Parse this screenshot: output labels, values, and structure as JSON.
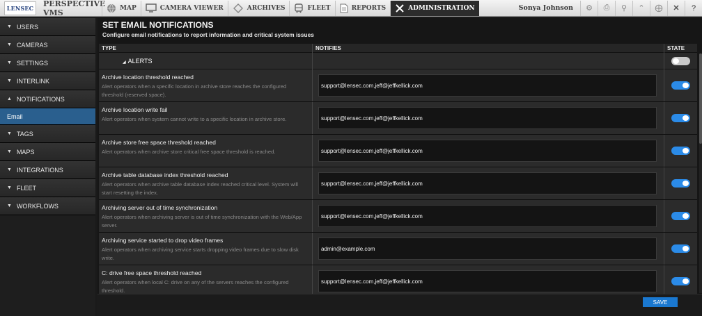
{
  "app": {
    "logo": "LENSEC",
    "product": "PERSPECTIVE VMS",
    "user": "Sonya Johnson"
  },
  "nav": [
    {
      "label": "MAP",
      "icon": "globe-icon"
    },
    {
      "label": "CAMERA VIEWER",
      "icon": "monitor-icon"
    },
    {
      "label": "ARCHIVES",
      "icon": "archive-icon"
    },
    {
      "label": "FLEET",
      "icon": "bus-icon"
    },
    {
      "label": "REPORTS",
      "icon": "document-icon"
    },
    {
      "label": "ADMINISTRATION",
      "icon": "tools-icon",
      "active": true
    }
  ],
  "toolbar_icons": [
    "gear-icon",
    "printer-icon",
    "search-icon",
    "collapse-icon",
    "fullscreen-icon",
    "close-icon",
    "help-icon"
  ],
  "sidebar": [
    {
      "label": "USERS",
      "expanded": false
    },
    {
      "label": "CAMERAS",
      "expanded": false
    },
    {
      "label": "SETTINGS",
      "expanded": false
    },
    {
      "label": "INTERLINK",
      "expanded": false
    },
    {
      "label": "NOTIFICATIONS",
      "expanded": true
    },
    {
      "label": "Email",
      "sub": true
    },
    {
      "label": "TAGS",
      "expanded": false
    },
    {
      "label": "MAPS",
      "expanded": false
    },
    {
      "label": "INTEGRATIONS",
      "expanded": false
    },
    {
      "label": "FLEET",
      "expanded": false
    },
    {
      "label": "WORKFLOWS",
      "expanded": false
    }
  ],
  "page": {
    "title": "SET EMAIL NOTIFICATIONS",
    "subtitle": "Configure email notifications to report information and critical system issues"
  },
  "table": {
    "headers": {
      "type": "TYPE",
      "notifies": "NOTIFIES",
      "state": "STATE"
    },
    "group": {
      "label": "ALERTS",
      "state": false
    },
    "rows": [
      {
        "name": "Archive location threshold reached",
        "desc": "Alert operators when a specific location in archive store reaches the configured threshold (reserved space).",
        "email": "support@lensec.com,jeff@jeffkellick.com",
        "state": true
      },
      {
        "name": "Archive location write fail",
        "desc": "Alert operators when system cannot write to a specific location in archive store.",
        "email": "support@lensec.com,jeff@jeffkellick.com",
        "state": true
      },
      {
        "name": "Archive store free space threshold reached",
        "desc": "Alert operators when archive store critical free space threshold is reached.",
        "email": "support@lensec.com,jeff@jeffkellick.com",
        "state": true
      },
      {
        "name": "Archive table database index threshold reached",
        "desc": "Alert operators when archive table database index reached critical level. System will start resetting the index.",
        "email": "support@lensec.com,jeff@jeffkellick.com",
        "state": true
      },
      {
        "name": "Archiving server out of time synchronization",
        "desc": "Alert operators when archiving server is out of time synchronization with the Web/App server.",
        "email": "support@lensec.com,jeff@jeffkellick.com",
        "state": true
      },
      {
        "name": "Archiving service started to drop video frames",
        "desc": "Alert operators when archiving service starts dropping video frames due to slow disk write.",
        "email": "admin@example.com",
        "state": true
      },
      {
        "name": "C: drive free space threshold reached",
        "desc": "Alert operators when local C: drive on any of the servers reaches the configured threshold.",
        "email": "support@lensec.com,jeff@jeffkellick.com",
        "state": true
      }
    ]
  },
  "footer": {
    "save_label": "SAVE"
  },
  "colors": {
    "accent": "#2b8be8",
    "selected_nav": "#2a5f8e",
    "annotation_arrow": "#d42020"
  }
}
